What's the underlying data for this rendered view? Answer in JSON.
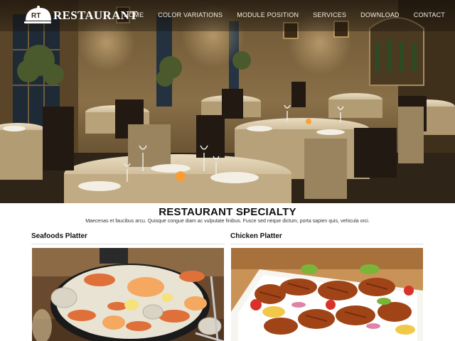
{
  "brand": {
    "monogram": "RT",
    "name": "RESTAURANT"
  },
  "nav": {
    "items": [
      {
        "label": "HOME"
      },
      {
        "label": "COLOR VARIATIONS"
      },
      {
        "label": "MODULE POSITION"
      },
      {
        "label": "SERVICES"
      },
      {
        "label": "DOWNLOAD"
      },
      {
        "label": "CONTACT"
      }
    ]
  },
  "hero": {
    "icon": "restaurant-dining-room-photo"
  },
  "specialty": {
    "title": "RESTAURANT SPECIALTY",
    "subtitle": "Maecenas et faucibus arcu. Quisque congue diam ac vulputate finibus. Fusce sed neque dictum, porta sapien quis, vehicula orci."
  },
  "dishes": [
    {
      "title": "Seafoods Platter",
      "icon": "seafood-platter-photo"
    },
    {
      "title": "Chicken Platter",
      "icon": "grilled-chicken-platter-photo"
    }
  ]
}
